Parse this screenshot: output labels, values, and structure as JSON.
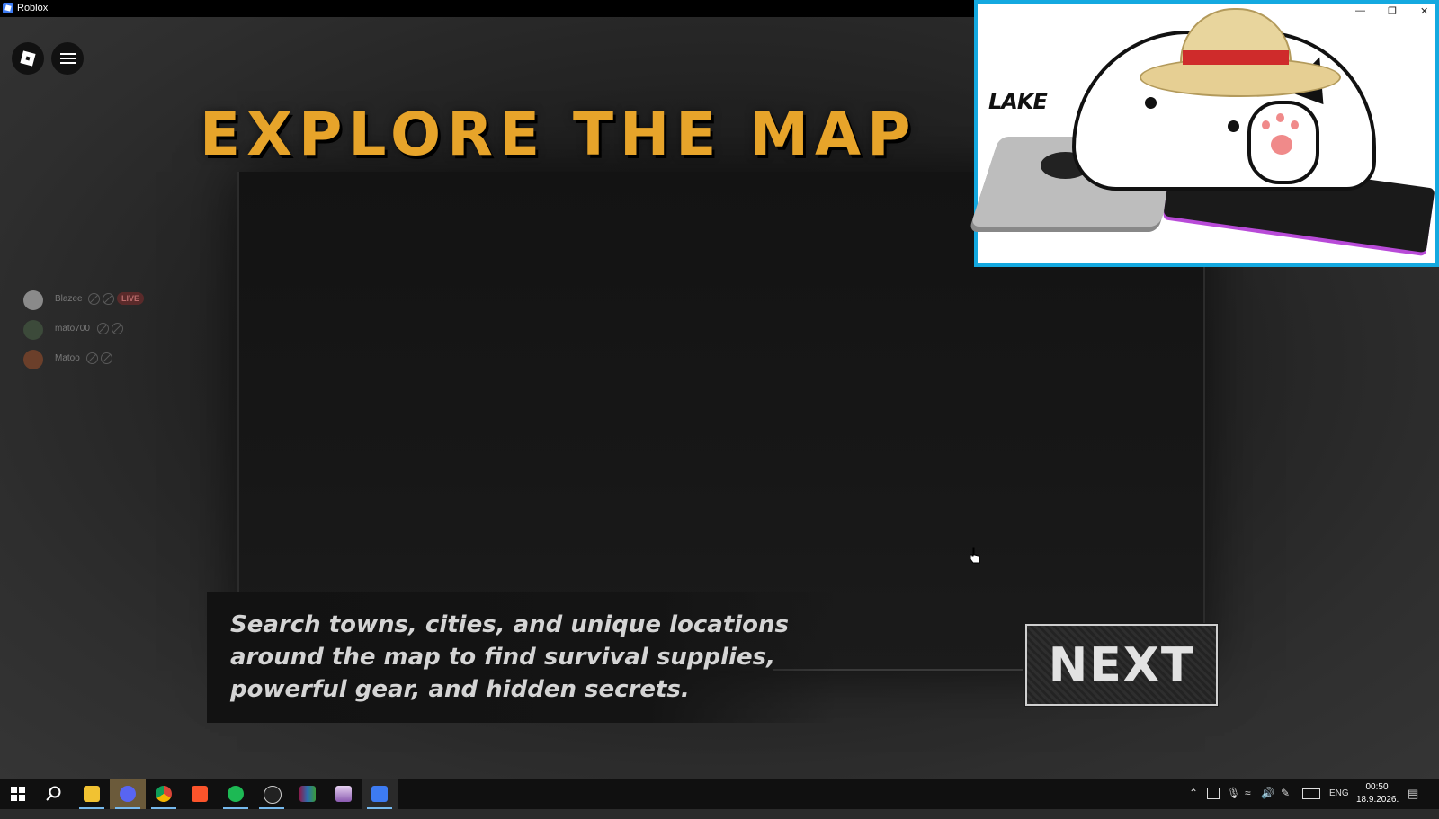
{
  "window": {
    "title": "Roblox"
  },
  "game": {
    "headline": "EXPLORE THE MAP",
    "description_lines": [
      "Search towns, cities, and unique locations",
      "around the map to find survival supplies,",
      "powerful gear, and hidden secrets."
    ],
    "next_label": "NEXT",
    "players": [
      {
        "name": "Blazee",
        "live": "LIVE"
      },
      {
        "name": "mato700"
      },
      {
        "name": "Matoo"
      }
    ]
  },
  "webcam": {
    "label": "LAKE"
  },
  "taskbar": {
    "language": "ENG",
    "time": "00:50",
    "date": "18.9.2026.",
    "apps": [
      "start-icon",
      "search-icon",
      "file-explorer-icon",
      "discord-icon",
      "chrome-icon",
      "brave-icon",
      "spotify-icon",
      "obs-icon",
      "winrar-icon",
      "image-app-icon",
      "roblox-icon"
    ]
  },
  "colors": {
    "headline": "#e7a42a",
    "webcam_border": "#14a9e0",
    "live_badge": "#5a2a2a"
  }
}
